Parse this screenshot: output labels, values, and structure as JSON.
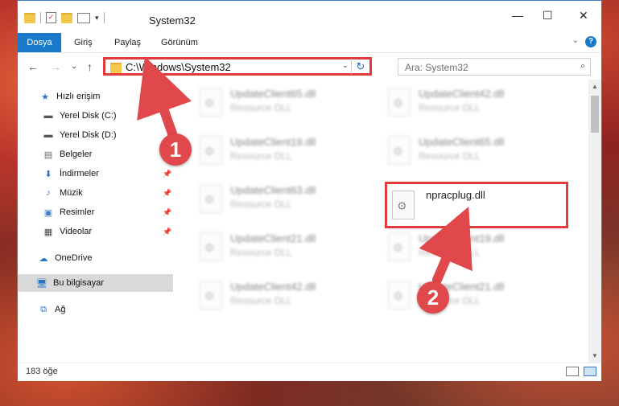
{
  "window": {
    "title": "System32",
    "controls": {
      "minimize": "—",
      "maximize": "☐",
      "close": "✕"
    }
  },
  "ribbon": {
    "tabs": [
      "Dosya",
      "Giriş",
      "Paylaş",
      "Görünüm"
    ],
    "help": "?",
    "collapse": "⌄"
  },
  "navigation": {
    "back": "←",
    "forward": "→",
    "recent": "⌄",
    "up": "↑",
    "address": "C:\\Windows\\System32",
    "address_dropdown": "⌄",
    "refresh": "↻",
    "search_placeholder": "Ara: System32"
  },
  "sidebar": {
    "items": [
      {
        "label": "Hızlı erişim",
        "icon": "star-icon"
      },
      {
        "label": "Yerel Disk (C:)",
        "icon": "drive-icon"
      },
      {
        "label": "Yerel Disk (D:)",
        "icon": "drive-icon"
      },
      {
        "label": "Belgeler",
        "icon": "document-icon"
      },
      {
        "label": "İndirmeler",
        "icon": "download-icon"
      },
      {
        "label": "Müzik",
        "icon": "music-icon"
      },
      {
        "label": "Resimler",
        "icon": "pictures-icon"
      },
      {
        "label": "Videolar",
        "icon": "video-icon"
      },
      {
        "label": "OneDrive",
        "icon": "cloud-icon"
      },
      {
        "label": "Bu bilgisayar",
        "icon": "computer-icon"
      },
      {
        "label": "Ağ",
        "icon": "network-icon"
      }
    ]
  },
  "files": [
    {
      "name": "UpdateClient65.dll",
      "type": "Resource DLL"
    },
    {
      "name": "UpdateClient42.dll",
      "type": "Resource DLL"
    },
    {
      "name": "UpdateClient19.dll",
      "type": "Resource DLL"
    },
    {
      "name": "UpdateClient65.dll",
      "type": "Resource DLL"
    },
    {
      "name": "UpdateClient63.dll",
      "type": "Resource DLL"
    },
    {
      "name": "npracplug.dll",
      "type": ""
    },
    {
      "name": "UpdateClient21.dll",
      "type": "Resource DLL"
    },
    {
      "name": "UpdateClient19.dll",
      "type": "Resource DLL"
    },
    {
      "name": "UpdateClient42.dll",
      "type": "Resource DLL"
    },
    {
      "name": "UpdateClient21.dll",
      "type": "Resource DLL"
    }
  ],
  "status": {
    "count": "183 öğe"
  },
  "annotations": {
    "step1": "1",
    "step2": "2",
    "color": "#e0484b"
  }
}
